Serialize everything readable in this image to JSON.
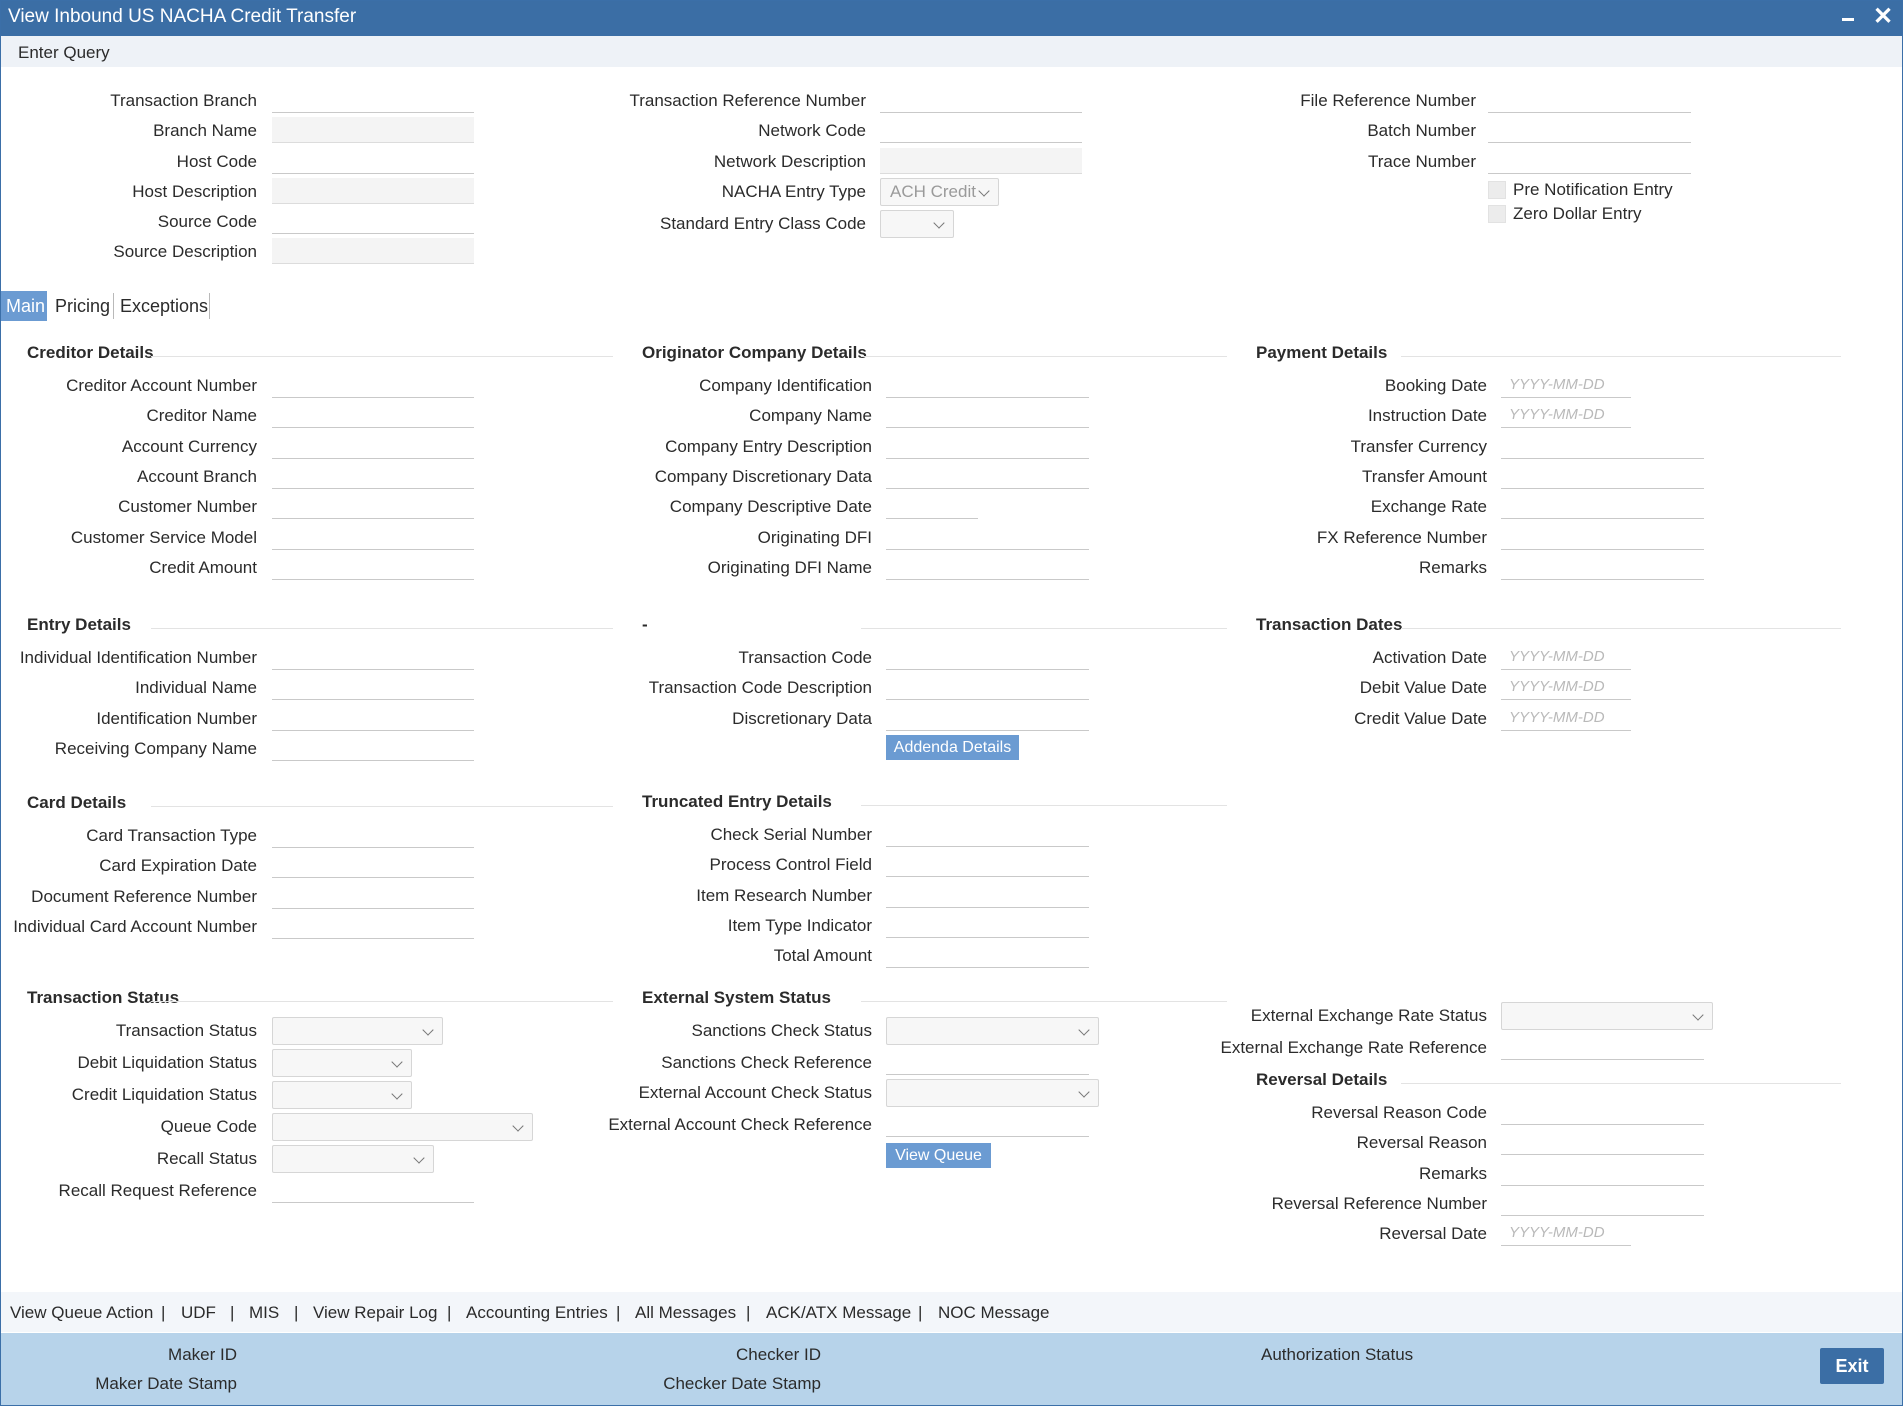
{
  "window": {
    "title": "View Inbound US NACHA Credit Transfer",
    "minimize_label": "",
    "close_label": "✕"
  },
  "query": {
    "label": "Enter Query"
  },
  "header": {
    "transaction_branch": "Transaction Branch",
    "branch_name": "Branch Name",
    "host_code": "Host Code",
    "host_description": "Host Description",
    "source_code": "Source Code",
    "source_description": "Source Description",
    "transaction_reference_number": "Transaction Reference Number",
    "network_code": "Network Code",
    "network_description": "Network Description",
    "nacha_entry_type": "NACHA Entry Type",
    "nacha_entry_type_value": "ACH Credit",
    "standard_entry_class_code": "Standard Entry Class Code",
    "file_reference_number": "File Reference Number",
    "batch_number": "Batch Number",
    "trace_number": "Trace Number",
    "pre_notification_entry": "Pre Notification Entry",
    "zero_dollar_entry": "Zero Dollar Entry"
  },
  "tabs": [
    "Main",
    "Pricing",
    "Exceptions"
  ],
  "creditor": {
    "title": "Creditor Details",
    "labels": [
      "Creditor Account Number",
      "Creditor Name",
      "Account Currency",
      "Account Branch",
      "Customer Number",
      "Customer Service Model",
      "Credit Amount"
    ]
  },
  "originator": {
    "title": "Originator Company Details",
    "labels": [
      "Company Identification",
      "Company Name",
      "Company Entry Description",
      "Company Discretionary Data",
      "Company Descriptive Date",
      "Originating DFI",
      "Originating DFI Name"
    ]
  },
  "payment": {
    "title": "Payment Details",
    "labels": [
      "Booking Date",
      "Instruction Date",
      "Transfer Currency",
      "Transfer Amount",
      "Exchange Rate",
      "FX Reference Number",
      "Remarks"
    ],
    "date_placeholder": "YYYY-MM-DD"
  },
  "entry": {
    "title": "Entry Details",
    "labels": [
      "Individual Identification Number",
      "Individual Name",
      "Identification Number",
      "Receiving Company Name"
    ]
  },
  "transaction_code": {
    "title": "-",
    "labels": [
      "Transaction Code",
      "Transaction Code Description",
      "Discretionary Data"
    ],
    "addenda_button": "Addenda Details"
  },
  "transaction_dates": {
    "title": "Transaction Dates",
    "labels": [
      "Activation Date",
      "Debit Value Date",
      "Credit Value Date"
    ]
  },
  "card": {
    "title": "Card Details",
    "labels": [
      "Card Transaction Type",
      "Card Expiration Date",
      "Document Reference Number",
      "Individual Card Account Number"
    ]
  },
  "truncated": {
    "title": "Truncated Entry Details",
    "labels": [
      "Check Serial Number",
      "Process Control Field",
      "Item Research Number",
      "Item Type Indicator",
      "Total Amount"
    ]
  },
  "transaction_status": {
    "title": "Transaction Status",
    "labels": [
      "Transaction Status",
      "Debit Liquidation Status",
      "Credit Liquidation Status",
      "Queue Code",
      "Recall Status",
      "Recall Request Reference"
    ]
  },
  "external_status": {
    "title": "External System Status",
    "labels": [
      "Sanctions Check Status",
      "Sanctions Check Reference",
      "External Account Check Status",
      "External Account Check Reference"
    ],
    "view_queue_button": "View Queue"
  },
  "exchange": {
    "labels": [
      "External Exchange Rate Status",
      "External Exchange Rate Reference"
    ]
  },
  "reversal": {
    "title": "Reversal Details",
    "labels": [
      "Reversal Reason Code",
      "Reversal Reason",
      "Remarks",
      "Reversal Reference Number",
      "Reversal Date"
    ]
  },
  "links": [
    "View Queue Action",
    "UDF",
    "MIS",
    "View Repair Log",
    "Accounting Entries",
    "All Messages",
    "ACK/ATX Message",
    "NOC Message"
  ],
  "link_separator": "|",
  "footer": {
    "maker_id": "Maker ID",
    "maker_date_stamp": "Maker Date Stamp",
    "checker_id": "Checker ID",
    "checker_date_stamp": "Checker Date Stamp",
    "authorization_status": "Authorization Status",
    "exit": "Exit"
  }
}
